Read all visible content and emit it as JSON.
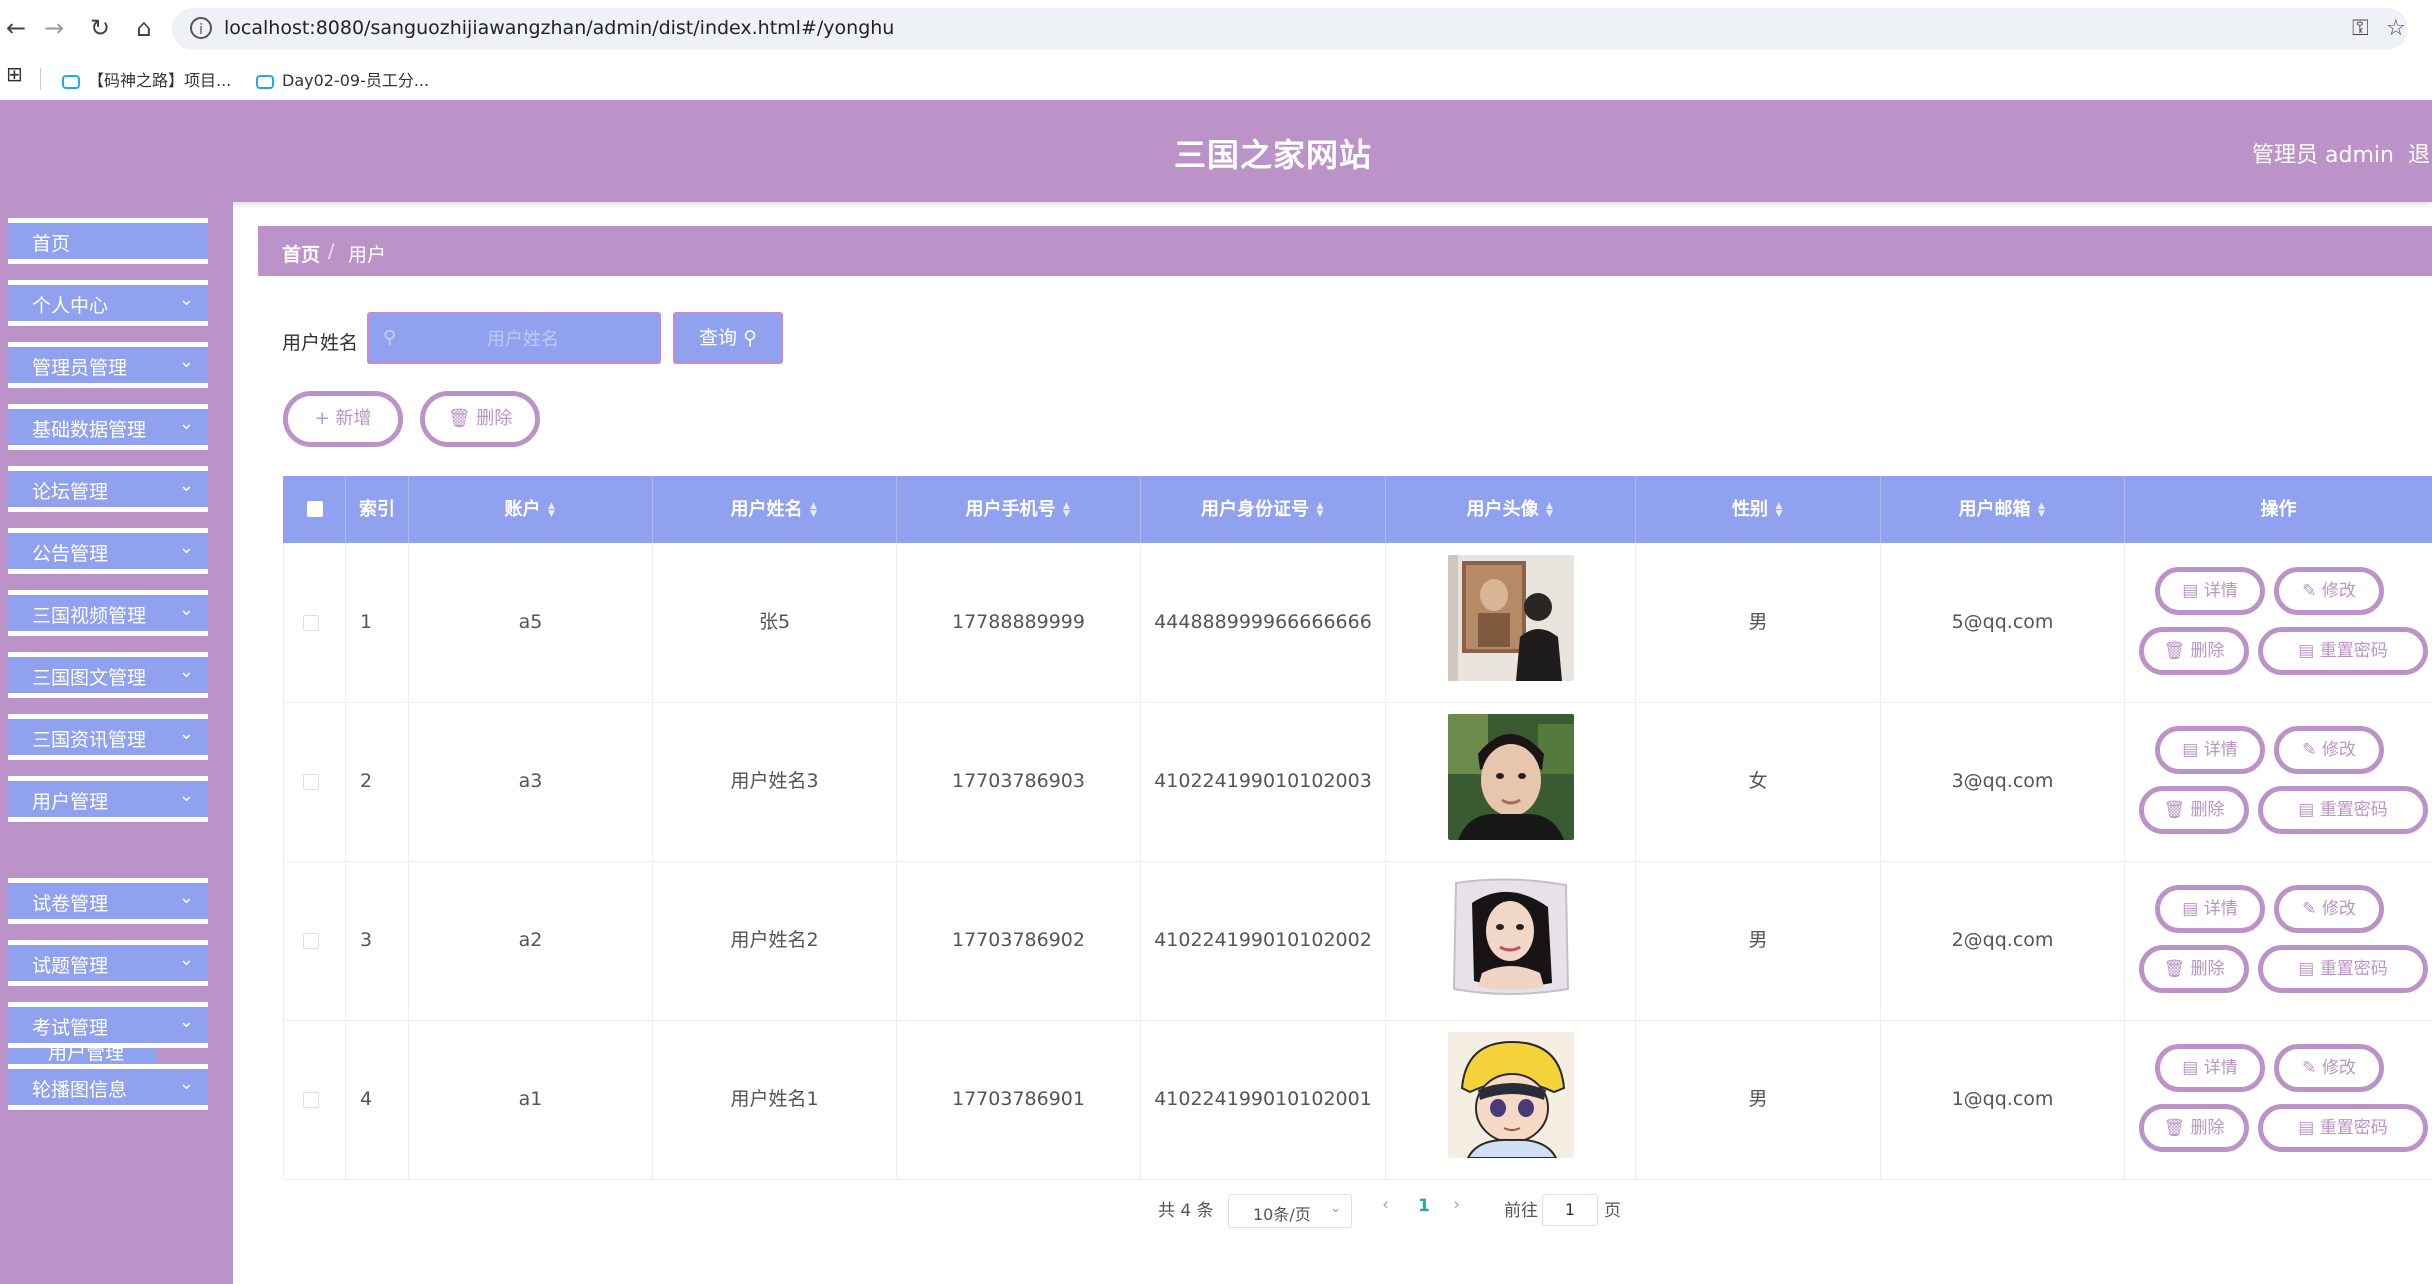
{
  "browser": {
    "url": "localhost:8080/sanguozhijiawangzhan/admin/dist/index.html#/yonghu",
    "bookmarks": [
      "【码神之路】项目...",
      "Day02-09-员工分..."
    ]
  },
  "header": {
    "title": "三国之家网站",
    "admin": "管理员 admin",
    "logout": "退出"
  },
  "sidebar": {
    "items": [
      {
        "label": "首页"
      },
      {
        "label": "个人中心"
      },
      {
        "label": "管理员管理"
      },
      {
        "label": "基础数据管理"
      },
      {
        "label": "论坛管理"
      },
      {
        "label": "公告管理"
      },
      {
        "label": "三国视频管理"
      },
      {
        "label": "三国图文管理"
      },
      {
        "label": "三国资讯管理"
      },
      {
        "label": "用户管理"
      },
      {
        "label": "试卷管理"
      },
      {
        "label": "试题管理"
      },
      {
        "label": "考试管理"
      },
      {
        "label": "轮播图信息"
      }
    ],
    "submenu": {
      "label": "用户管理"
    }
  },
  "breadcrumb": {
    "home": "首页",
    "sep": "/",
    "current": "用户"
  },
  "search": {
    "label": "用户姓名",
    "placeholder": "用户姓名",
    "query_label": "查询"
  },
  "actions": {
    "add": "新增",
    "delete": "删除"
  },
  "table": {
    "headers": [
      "索引",
      "账户",
      "用户姓名",
      "用户手机号",
      "用户身份证号",
      "用户头像",
      "性别",
      "用户邮箱",
      "操作"
    ],
    "row_buttons": {
      "detail": "详情",
      "edit": "修改",
      "delete": "删除",
      "reset": "重置密码"
    },
    "rows": [
      {
        "index": "1",
        "account": "a5",
        "name": "张5",
        "phone": "17788889999",
        "idcard": "444888999966666666",
        "gender": "男",
        "email": "5@qq.com"
      },
      {
        "index": "2",
        "account": "a3",
        "name": "用户姓名3",
        "phone": "17703786903",
        "idcard": "410224199010102003",
        "gender": "女",
        "email": "3@qq.com"
      },
      {
        "index": "3",
        "account": "a2",
        "name": "用户姓名2",
        "phone": "17703786902",
        "idcard": "410224199010102002",
        "gender": "男",
        "email": "2@qq.com"
      },
      {
        "index": "4",
        "account": "a1",
        "name": "用户姓名1",
        "phone": "17703786901",
        "idcard": "410224199010102001",
        "gender": "男",
        "email": "1@qq.com"
      }
    ]
  },
  "pagination": {
    "total": "共 4 条",
    "page_size": "10条/页",
    "current": "1",
    "goto_label": "前往",
    "goto_value": "1",
    "page_suffix": "页"
  },
  "colors": {
    "theme": "#bc93c8",
    "accent": "#8fa1ef",
    "active_page": "#22a8a6"
  }
}
